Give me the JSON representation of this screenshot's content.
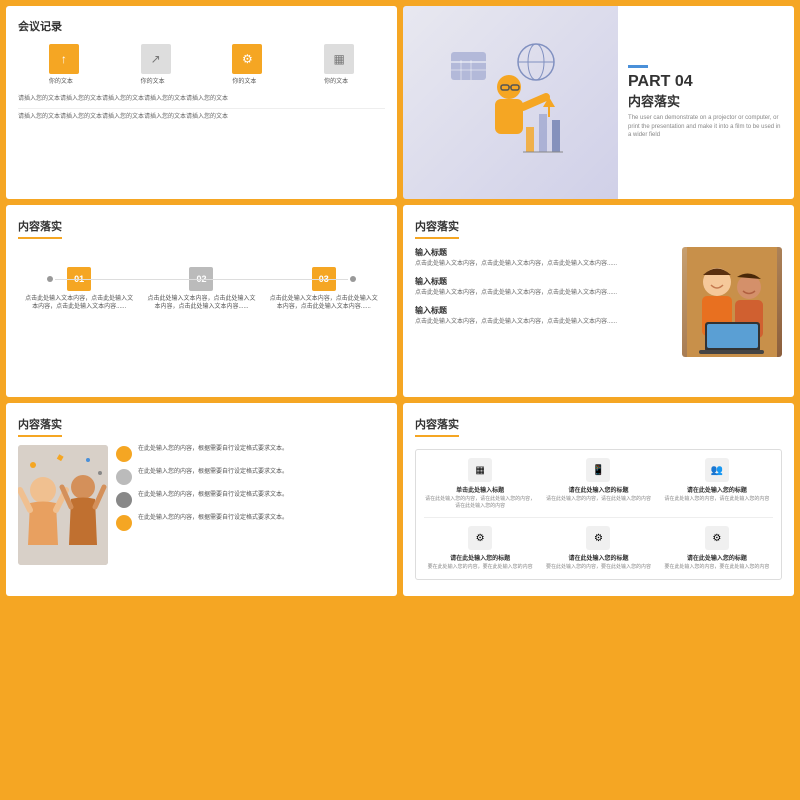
{
  "slides": [
    {
      "id": "slide-1",
      "title": "会议记录",
      "icons": [
        "↑",
        "↗",
        "⚙",
        "▦"
      ],
      "icon_labels": [
        "你的文本",
        "你的文本",
        "你的文本",
        "你的文本"
      ],
      "icon_colors": [
        "yellow",
        "gray",
        "yellow",
        "gray"
      ],
      "lines": [
        "请插入您的文本请插入您的文本请插入您的文本请插入您的文本请插入您的文本",
        "",
        "请插入您的文本请插入您的文本请插入您的文本请插入您的文本请插入您的文本"
      ]
    },
    {
      "id": "slide-2",
      "part_num": "PART 04",
      "part_title": "内容落实",
      "blue_bar": true,
      "description": "The user can demonstrate on a projector or computer, or print the presentation and make it into a film to be used in a wider field"
    },
    {
      "id": "slide-3",
      "title": "内容落实",
      "items": [
        {
          "num": "01",
          "color": "yellow",
          "text": "点击此处输入文本内容，点击此处输入文本内容，点击此处输入文本内容......"
        },
        {
          "num": "02",
          "color": "gray",
          "text": "点击此处输入文本内容，点击此处输入文本内容，点击此处输入文本内容......"
        },
        {
          "num": "03",
          "color": "yellow",
          "text": "点击此处输入文本内容，点击此处输入文本内容，点击此处输入文本内容......"
        }
      ]
    },
    {
      "id": "slide-4",
      "title": "内容落实",
      "text_blocks": [
        {
          "heading": "输入标题",
          "body": "点击此处输入文本内容，点击此处输入文本内容，点击此处输入文本内容......"
        },
        {
          "heading": "输入标题",
          "body": "点击此处输入文本内容，点击此处输入文本内容，点击此处输入文本内容......"
        },
        {
          "heading": "输入标题",
          "body": "点击此处输入文本内容，点击此处输入文本内容，点击此处输入文本内容......"
        }
      ]
    },
    {
      "id": "slide-5",
      "title": "内容落实",
      "list_items": [
        {
          "color": "yellow",
          "heading": "在此处输入您的内容，根据需要自行设定格式要求文本。",
          "text": ""
        },
        {
          "color": "gray",
          "heading": "在此处输入您的内容，根据需要自行设定格式要求文本。",
          "text": ""
        },
        {
          "color": "dark",
          "heading": "在此处输入您的内容，根据需要自行设定格式要求文本。",
          "text": ""
        },
        {
          "color": "yellow",
          "heading": "在此处输入您的内容，根据需要自行设定格式要求文本。",
          "text": ""
        }
      ]
    },
    {
      "id": "slide-6",
      "title": "内容落实",
      "top_items": [
        {
          "icon": "▦",
          "title": "单击此处输入标题",
          "text": "请在此处输入您的内容，请在此处输入您的内容，请在此处输入您的内容"
        },
        {
          "icon": "📱",
          "title": "请在此处输入您的标题",
          "text": "请在此处输入您的内容，请在此处输入您的内容"
        },
        {
          "icon": "👥",
          "title": "请在此处输入您的标题",
          "text": "请在此处输入您的内容，请在此处输入您的内容"
        }
      ],
      "bottom_items": [
        {
          "icon": "⚙",
          "title": "请在此处输入您的标题",
          "text": "要在此处输入您的内容，要在此处输入您的内容"
        },
        {
          "icon": "⚙",
          "title": "请在此处输入您的标题",
          "text": "要在此处输入您的内容，要在此处输入您的内容"
        },
        {
          "icon": "⚙",
          "title": "请在此处输入您的标题",
          "text": "要在此处输入您的内容，要在此处输入您的内容"
        }
      ]
    }
  ],
  "accent_color": "#f5a623",
  "gray_color": "#cccccc",
  "blue_color": "#4a90d9"
}
